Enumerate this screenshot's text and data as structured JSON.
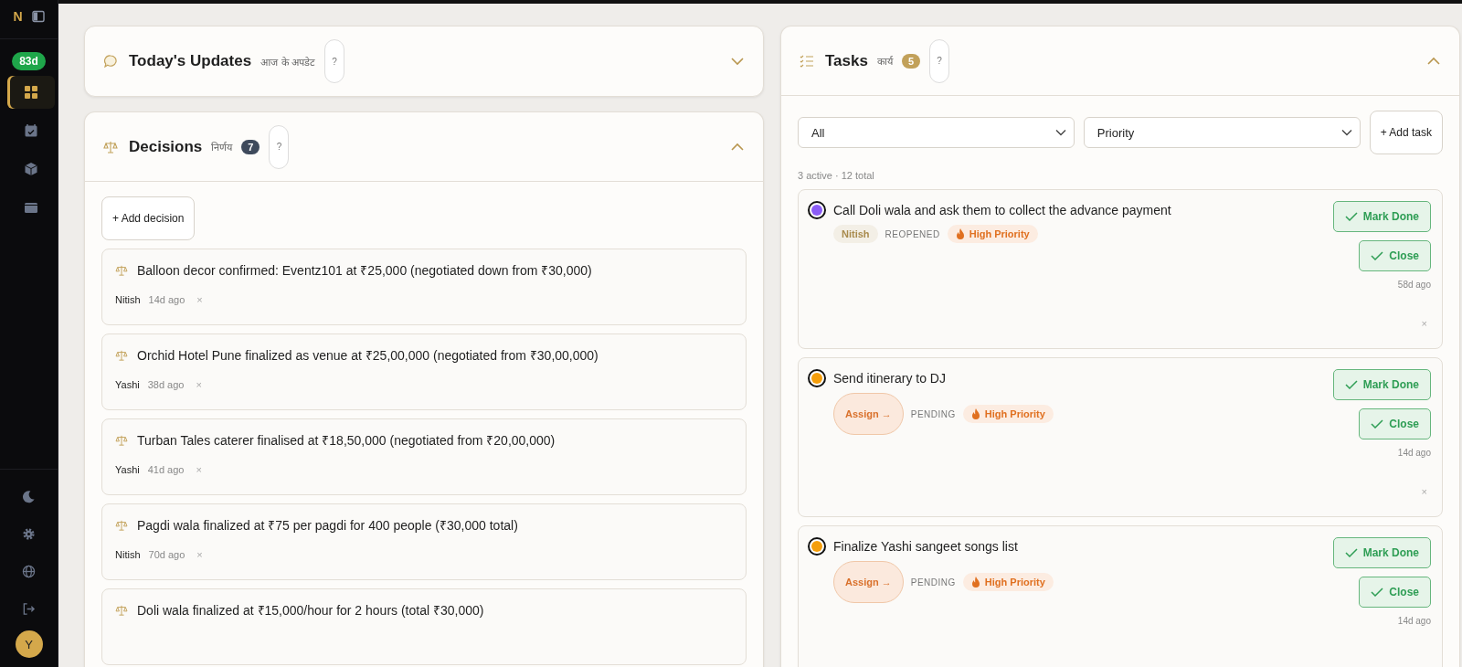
{
  "sidebar": {
    "logo": "N",
    "badge": "83d",
    "nav": [
      {
        "kind": "grid",
        "selected": true
      },
      {
        "kind": "calendar",
        "selected": false
      },
      {
        "kind": "box",
        "selected": false
      },
      {
        "kind": "wallet",
        "selected": false
      }
    ],
    "footer": [
      {
        "kind": "moon"
      },
      {
        "kind": "settings"
      },
      {
        "kind": "globe"
      },
      {
        "kind": "logout"
      }
    ],
    "avatar": "Y"
  },
  "updates": {
    "title": "Today's Updates",
    "subtitle": "आज के अपडेट",
    "help": "?",
    "expanded": false
  },
  "decisions": {
    "title": "Decisions",
    "subtitle": "निर्णय",
    "count": "7",
    "help": "?",
    "expanded": true,
    "add_button": "+ Add decision",
    "items": [
      {
        "text": "Balloon decor confirmed: Eventz101 at ₹25,000 (negotiated down from ₹30,000)",
        "author": "Nitish",
        "time": "14d ago",
        "delete": "×"
      },
      {
        "text": "Orchid Hotel Pune finalized as venue at ₹25,00,000 (negotiated from ₹30,00,000)",
        "author": "Yashi",
        "time": "38d ago",
        "delete": "×"
      },
      {
        "text": "Turban Tales caterer finalised at ₹18,50,000 (negotiated from ₹20,00,000)",
        "author": "Yashi",
        "time": "41d ago",
        "delete": "×"
      },
      {
        "text": "Pagdi wala finalized at ₹75 per pagdi for 400 people (₹30,000 total)",
        "author": "Nitish",
        "time": "70d ago",
        "delete": "×"
      },
      {
        "text": "Doli wala finalized at ₹15,000/hour for 2 hours (total ₹30,000)"
      }
    ]
  },
  "tasks": {
    "title": "Tasks",
    "subtitle": "कार्य",
    "count": "5",
    "help": "?",
    "expanded": true,
    "filters": [
      {
        "value": "All"
      },
      {
        "value": "Priority"
      }
    ],
    "add_button": "+ Add task",
    "summary": "3 active · 12 total",
    "items": [
      {
        "color": "#8b5cf6",
        "title": "Call Doli wala and ask them to collect the advance payment",
        "assignee": "Nitish",
        "status": "REOPENED",
        "priority": "High Priority",
        "mark_done": "Mark Done",
        "close": "Close",
        "time": "58d ago",
        "delete": "×"
      },
      {
        "color": "#f59e0b",
        "title": "Send itinerary to DJ",
        "assign_button": "Assign →",
        "status": "PENDING",
        "priority": "High Priority",
        "mark_done": "Mark Done",
        "close": "Close",
        "time": "14d ago",
        "delete": "×"
      },
      {
        "color": "#f59e0b",
        "title": "Finalize Yashi sangeet songs list",
        "assign_button": "Assign →",
        "status": "PENDING",
        "priority": "High Priority",
        "mark_done": "Mark Done",
        "close": "Close",
        "time": "14d ago"
      }
    ]
  }
}
